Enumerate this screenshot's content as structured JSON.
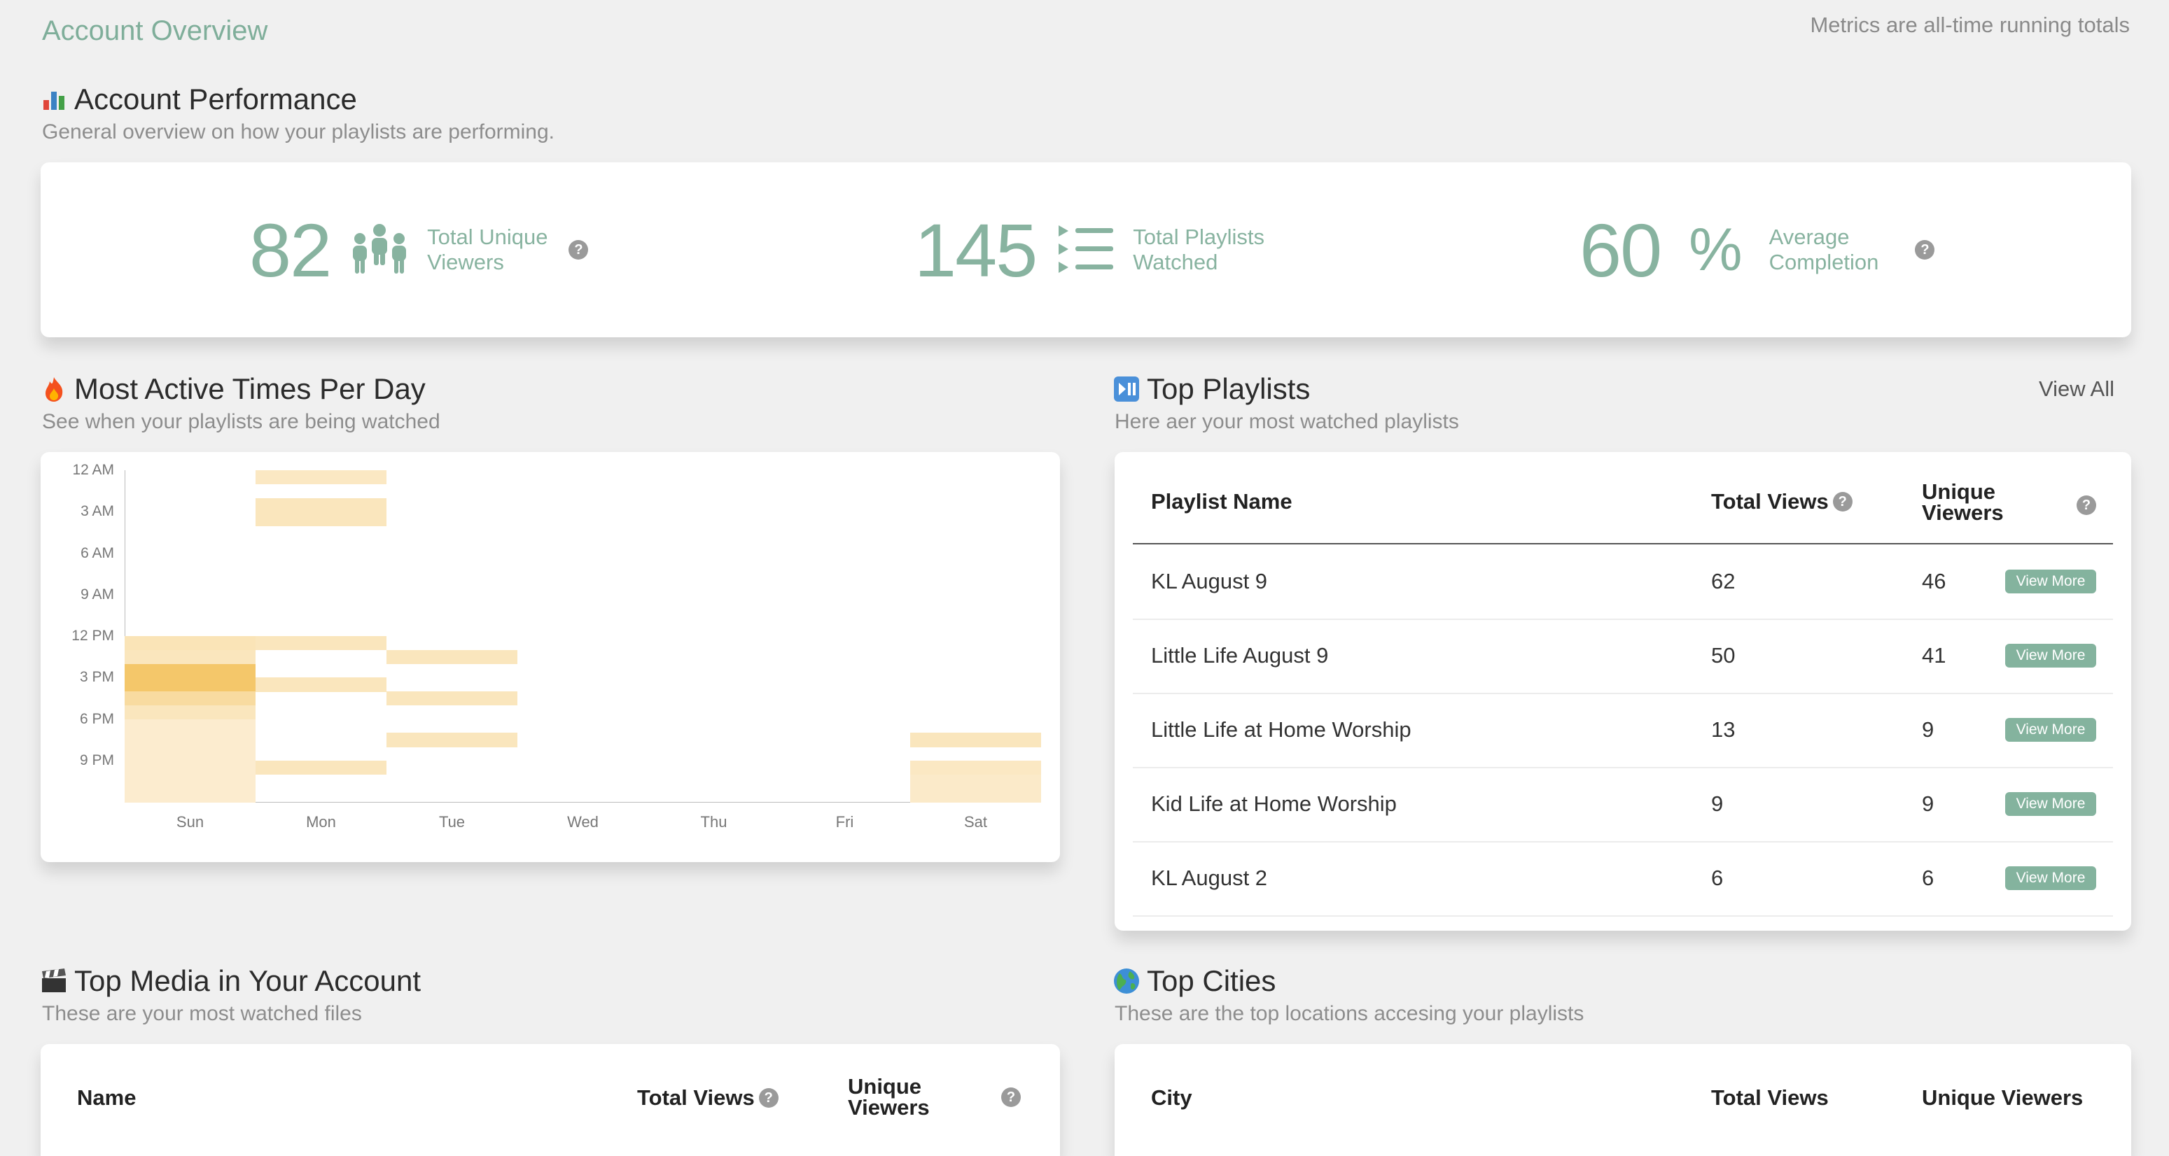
{
  "header": {
    "title": "Account Overview",
    "metrics_note": "Metrics are all-time running totals"
  },
  "performance": {
    "title": "Account Performance",
    "subtitle": "General overview on how your playlists are performing.",
    "stats": [
      {
        "value": "82",
        "unit": "",
        "label_line1": "Total Unique",
        "label_line2": "Viewers",
        "icon": "people-icon",
        "has_help": true
      },
      {
        "value": "145",
        "unit": "",
        "label_line1": "Total Playlists",
        "label_line2": "Watched",
        "icon": "playlist-icon",
        "has_help": false
      },
      {
        "value": "60",
        "unit": "%",
        "label_line1": "Average",
        "label_line2": "Completion",
        "icon": "",
        "has_help": true
      }
    ]
  },
  "active_times": {
    "title": "Most Active Times Per Day",
    "subtitle": "See when your playlists are being watched",
    "icon": "fire-icon"
  },
  "chart_data": {
    "type": "heatmap",
    "x_categories": [
      "Sun",
      "Mon",
      "Tue",
      "Wed",
      "Thu",
      "Fri",
      "Sat"
    ],
    "y_tick_labels": [
      "12 AM",
      "3 AM",
      "6 AM",
      "9 AM",
      "12 PM",
      "3 PM",
      "6 PM",
      "9 PM"
    ],
    "y_hours": [
      0,
      1,
      2,
      3,
      4,
      5,
      6,
      7,
      8,
      9,
      10,
      11,
      12,
      13,
      14,
      15,
      16,
      17,
      18,
      19,
      20,
      21,
      22,
      23
    ],
    "color_low": "#fdf3e1",
    "color_high": "#f4c76a",
    "cells": [
      {
        "day": "Mon",
        "hour": 0,
        "value": 0.25
      },
      {
        "day": "Mon",
        "hour": 2,
        "value": 0.3
      },
      {
        "day": "Mon",
        "hour": 3,
        "value": 0.3
      },
      {
        "day": "Sun",
        "hour": 12,
        "value": 0.35
      },
      {
        "day": "Sun",
        "hour": 13,
        "value": 0.3
      },
      {
        "day": "Sun",
        "hour": 14,
        "value": 1.0
      },
      {
        "day": "Sun",
        "hour": 15,
        "value": 1.0
      },
      {
        "day": "Sun",
        "hour": 16,
        "value": 0.55
      },
      {
        "day": "Sun",
        "hour": 17,
        "value": 0.3
      },
      {
        "day": "Sun",
        "hour": 18,
        "value": 0.15
      },
      {
        "day": "Sun",
        "hour": 19,
        "value": 0.15
      },
      {
        "day": "Sun",
        "hour": 20,
        "value": 0.15
      },
      {
        "day": "Sun",
        "hour": 21,
        "value": 0.15
      },
      {
        "day": "Sun",
        "hour": 22,
        "value": 0.15
      },
      {
        "day": "Sun",
        "hour": 23,
        "value": 0.15
      },
      {
        "day": "Mon",
        "hour": 12,
        "value": 0.3
      },
      {
        "day": "Mon",
        "hour": 15,
        "value": 0.3
      },
      {
        "day": "Mon",
        "hour": 21,
        "value": 0.3
      },
      {
        "day": "Tue",
        "hour": 13,
        "value": 0.3
      },
      {
        "day": "Tue",
        "hour": 16,
        "value": 0.3
      },
      {
        "day": "Tue",
        "hour": 19,
        "value": 0.3
      },
      {
        "day": "Sat",
        "hour": 19,
        "value": 0.3
      },
      {
        "day": "Sat",
        "hour": 21,
        "value": 0.25
      },
      {
        "day": "Sat",
        "hour": 22,
        "value": 0.2
      },
      {
        "day": "Sat",
        "hour": 23,
        "value": 0.2
      }
    ]
  },
  "top_playlists": {
    "title": "Top Playlists",
    "subtitle": "Here aer your most watched playlists",
    "view_all": "View All",
    "icon": "play-pause-icon",
    "columns": {
      "name": "Playlist Name",
      "views": "Total Views",
      "unique_line1": "Unique",
      "unique_line2": "Viewers"
    },
    "view_more_label": "View More",
    "rows": [
      {
        "name": "KL August 9",
        "views": "62",
        "unique": "46"
      },
      {
        "name": "Little Life August 9",
        "views": "50",
        "unique": "41"
      },
      {
        "name": "Little Life at Home Worship",
        "views": "13",
        "unique": "9"
      },
      {
        "name": "Kid Life at Home Worship",
        "views": "9",
        "unique": "9"
      },
      {
        "name": "KL August 2",
        "views": "6",
        "unique": "6"
      }
    ]
  },
  "top_media": {
    "title": "Top Media in Your Account",
    "subtitle": "These are your most watched files",
    "icon": "clapper-icon",
    "columns": {
      "name": "Name",
      "views": "Total Views",
      "unique_line1": "Unique",
      "unique_line2": "Viewers"
    }
  },
  "top_cities": {
    "title": "Top Cities",
    "subtitle": "These are the top locations accesing your playlists",
    "icon": "globe-icon",
    "columns": {
      "city": "City",
      "views": "Total Views",
      "unique": "Unique Viewers"
    }
  }
}
